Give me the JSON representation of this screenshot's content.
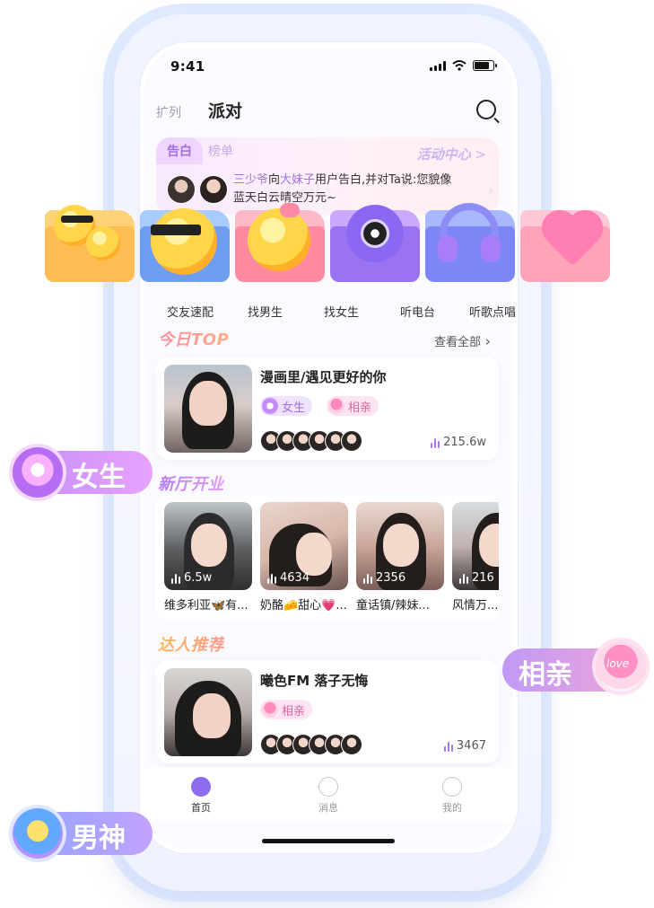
{
  "status_bar": {
    "time": "9:41"
  },
  "header": {
    "left_tab": "扩列",
    "title": "派对"
  },
  "banner": {
    "tab_active": "告白",
    "tab_inactive": "榜单",
    "activity_center": "活动中心",
    "message_prefix": "三少爷",
    "message_mid": "向",
    "message_target": "大妹子",
    "message_rest": "用户告白,并对Ta说:您貌像蓝天白云晴空万元~"
  },
  "categories": [
    "交友速配",
    "找男生",
    "找女生",
    "听电台",
    "听歌点唱"
  ],
  "today_top": {
    "title": "今日TOP",
    "see_all": "查看全部",
    "card": {
      "name": "漫画里/遇见更好的你",
      "tags": [
        "女生",
        "相亲"
      ],
      "heat": "215.6w"
    }
  },
  "new_halls": {
    "title": "新厅开业",
    "items": [
      {
        "name": "维多利亚🦋有...",
        "count": "6.5w"
      },
      {
        "name": "奶酪🧀甜心💗...",
        "count": "4634"
      },
      {
        "name": "童话镇/辣妹...",
        "count": "2356"
      },
      {
        "name": "风情万...",
        "count": "216"
      }
    ]
  },
  "talent": {
    "title": "达人推荐",
    "card": {
      "name": "曦色FM 落子无悔",
      "tags": [
        "相亲"
      ],
      "heat": "3467"
    }
  },
  "tabbar": {
    "home": "首页",
    "messages": "消息",
    "mine": "我的"
  },
  "floating_tags": {
    "girl": "女生",
    "date": "相亲",
    "god": "男神",
    "heart_text": "love"
  },
  "colors": {
    "accent_purple": "#a071e8",
    "banner_pink": "#fff1f8",
    "tag_purple": "#efe3ff",
    "tag_pink": "#fde4f2"
  }
}
